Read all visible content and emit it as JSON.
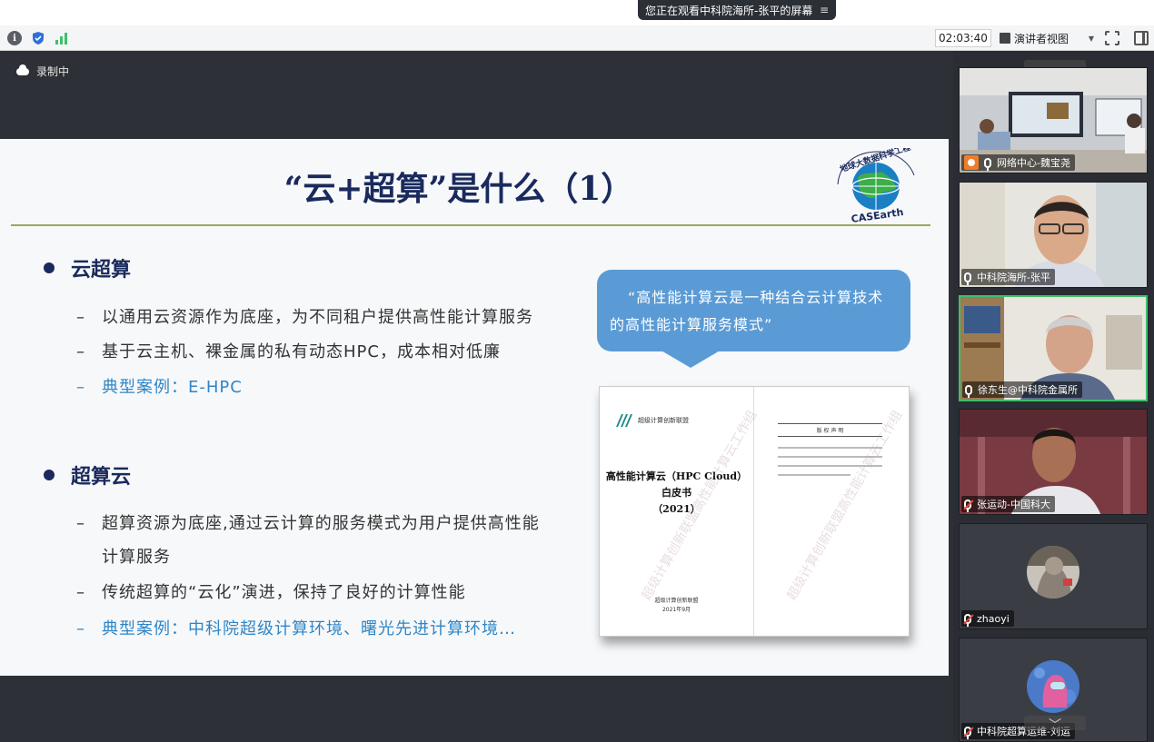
{
  "share_banner": {
    "text": "您正在观看中科院海所-张平的屏幕",
    "menu_icon": "≡"
  },
  "toolbar": {
    "timer": "02:03:40",
    "presenter_view": "演讲者视图",
    "icons": [
      "info-icon",
      "shield-icon",
      "signal-icon",
      "fullscreen-icon",
      "side-panel-icon"
    ]
  },
  "recording": {
    "label": "录制中"
  },
  "slide": {
    "title": "“云+超算”是什么（1）",
    "logo_text": "地球大数据科学工程",
    "logo_sub": "CASEarth",
    "sections": [
      {
        "heading": "云超算",
        "items": [
          "以通用云资源作为底座，为不同租户提供高性能计算服务",
          "基于云主机、裸金属的私有动态HPC，成本相对低廉",
          "典型案例：E-HPC"
        ]
      },
      {
        "heading": "超算云",
        "items": [
          "超算资源为底座,通过云计算的服务模式为用户提供高性能",
          "计算服务",
          "传统超算的“云化”演进，保持了良好的计算性能",
          "典型案例：中科院超级计算环境、曙光先进计算环境…"
        ]
      }
    ],
    "callout": {
      "line1": "“高性能计算云是一种结合云计算技术",
      "line2": "的高性能计算服务模式”"
    },
    "book": {
      "publisher": "超级计算创新联盟",
      "title_line1": "高性能计算云（HPC Cloud）",
      "title_line2": "白皮书",
      "title_line3": "（2021）",
      "footer_line1": "超级计算创新联盟",
      "footer_line2": "2021年9月",
      "right_page_title": "版 权 声 明",
      "watermark": "超级计算创新联盟高性能计算云工作组"
    }
  },
  "participants": [
    {
      "name": "网络中心-魏宝尧",
      "mic": "on",
      "tag": "host"
    },
    {
      "name": "中科院海所-张平",
      "mic": "on"
    },
    {
      "name": "徐东生@中科院金属所",
      "mic": "on",
      "active": true
    },
    {
      "name": "张运动-中国科大",
      "mic": "off"
    },
    {
      "name": "zhaoyi",
      "mic": "off"
    },
    {
      "name": "中科院超算运维-刘运",
      "mic": "off"
    }
  ],
  "colors": {
    "accent_green": "#3fbf6a",
    "slide_title": "#1a2a5c",
    "callout": "#5b9bd5",
    "link_blue": "#2f86c6"
  }
}
